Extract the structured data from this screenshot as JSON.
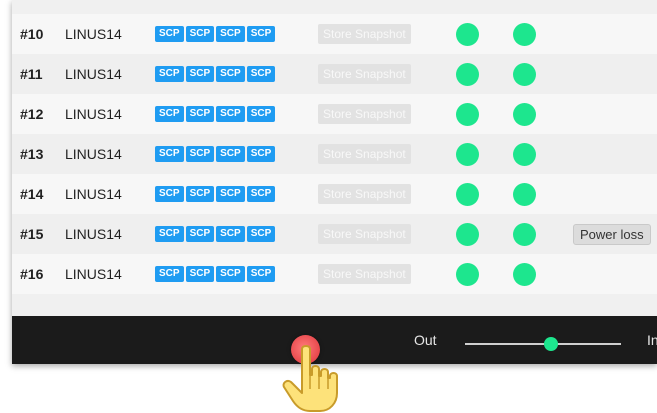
{
  "rows": [
    {
      "num": "#10",
      "name": "LINUS14",
      "scp": [
        "SCP",
        "SCP",
        "SCP",
        "SCP"
      ],
      "snapshot": "Store Snapshot",
      "badge": ""
    },
    {
      "num": "#11",
      "name": "LINUS14",
      "scp": [
        "SCP",
        "SCP",
        "SCP",
        "SCP"
      ],
      "snapshot": "Store Snapshot",
      "badge": ""
    },
    {
      "num": "#12",
      "name": "LINUS14",
      "scp": [
        "SCP",
        "SCP",
        "SCP",
        "SCP"
      ],
      "snapshot": "Store Snapshot",
      "badge": ""
    },
    {
      "num": "#13",
      "name": "LINUS14",
      "scp": [
        "SCP",
        "SCP",
        "SCP",
        "SCP"
      ],
      "snapshot": "Store Snapshot",
      "badge": ""
    },
    {
      "num": "#14",
      "name": "LINUS14",
      "scp": [
        "SCP",
        "SCP",
        "SCP",
        "SCP"
      ],
      "snapshot": "Store Snapshot",
      "badge": ""
    },
    {
      "num": "#15",
      "name": "LINUS14",
      "scp": [
        "SCP",
        "SCP",
        "SCP",
        "SCP"
      ],
      "snapshot": "Store Snapshot",
      "badge": "Power loss"
    },
    {
      "num": "#16",
      "name": "LINUS14",
      "scp": [
        "SCP",
        "SCP",
        "SCP",
        "SCP"
      ],
      "snapshot": "Store Snapshot",
      "badge": ""
    }
  ],
  "bottom_bar": {
    "out_label": "Out",
    "in_label": "In",
    "slider_value": 0.5
  },
  "colors": {
    "status_ok": "#1de68e",
    "scp_tag": "#1f9cf2",
    "record_button": "#e8484c",
    "bar_background": "#1b1b1b"
  },
  "icons": {
    "pointer": "hand-pointer-icon",
    "record": "record-button-icon"
  }
}
